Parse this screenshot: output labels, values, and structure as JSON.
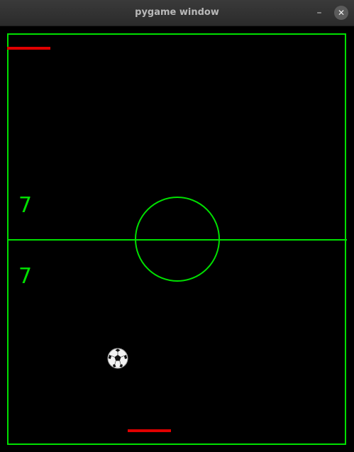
{
  "window": {
    "title": "pygame window",
    "minimize_glyph": "–",
    "close_glyph": "✕"
  },
  "game": {
    "score_top": "7",
    "score_bottom": "7",
    "colors": {
      "field_lines": "#00e000",
      "paddles": "#e00000",
      "background": "#000000"
    },
    "ball_icon": "soccer-ball-icon"
  }
}
